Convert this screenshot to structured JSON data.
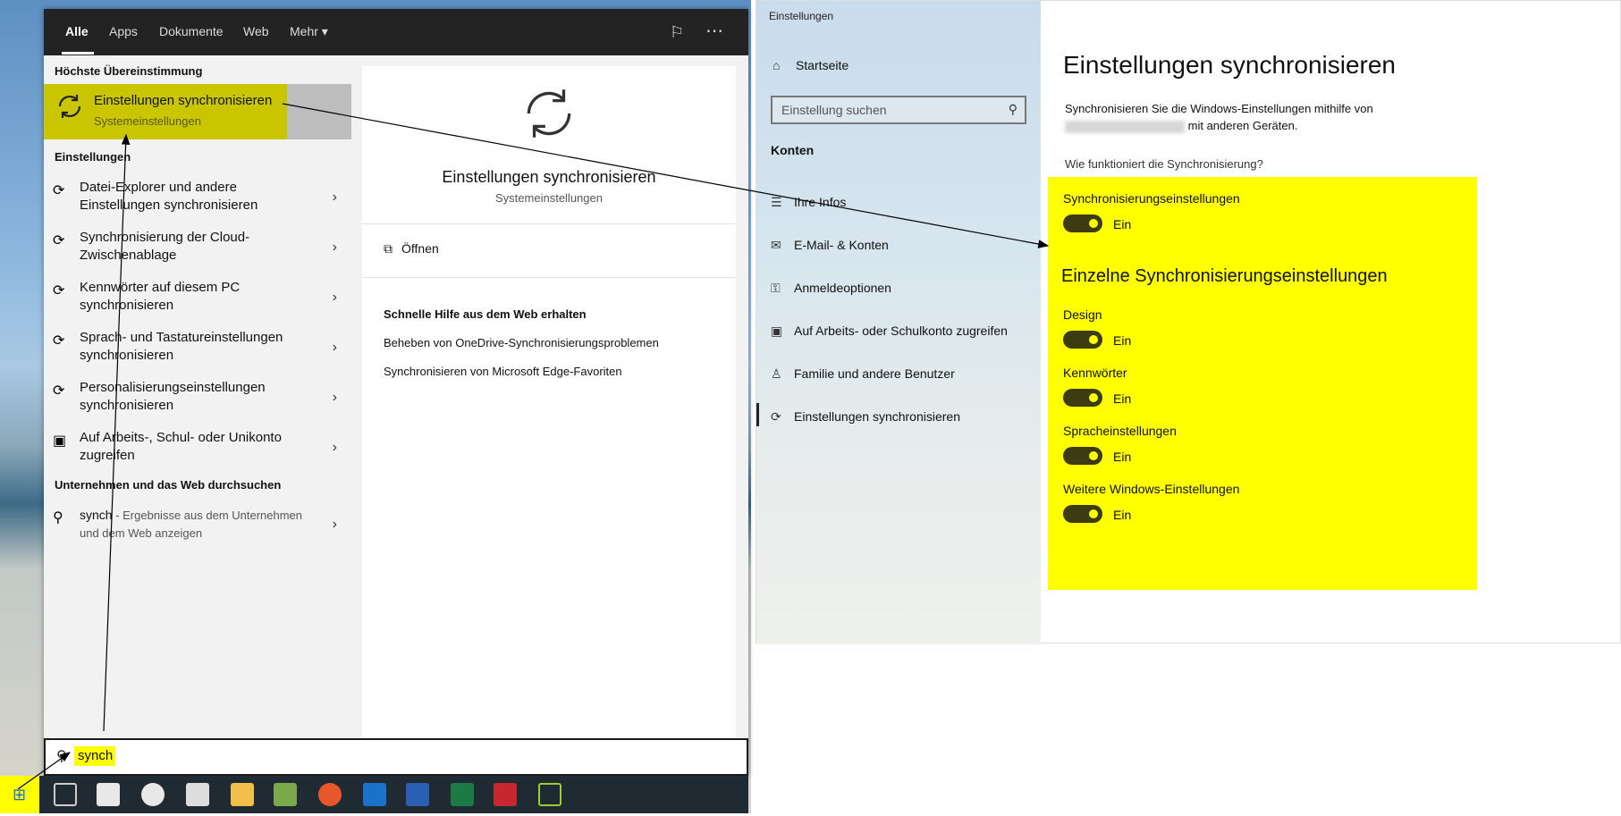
{
  "start_menu": {
    "tabs": [
      "Alle",
      "Apps",
      "Dokumente",
      "Web",
      "Mehr"
    ],
    "best_match_heading": "Höchste Übereinstimmung",
    "best_match": {
      "title": "Einstellungen synchronisieren",
      "subtitle": "Systemeinstellungen"
    },
    "settings_heading": "Einstellungen",
    "results": [
      {
        "line1": "Datei-Explorer und andere",
        "line2": "Einstellungen synchronisieren"
      },
      {
        "line1": "Synchronisierung der Cloud-",
        "line2": "Zwischenablage"
      },
      {
        "line1": "Kennwörter auf diesem PC",
        "line2": "synchronisieren"
      },
      {
        "line1": "Sprach- und Tastatureinstellungen",
        "line2": "synchronisieren"
      },
      {
        "line1": "Personalisierungseinstellungen",
        "line2": "synchronisieren"
      },
      {
        "line1": "Auf Arbeits-, Schul- oder Unikonto",
        "line2": "zugreifen"
      }
    ],
    "web_heading": "Unternehmen und das Web durchsuchen",
    "web_result": {
      "query": "synch",
      "line1": " - Ergebnisse aus dem Unternehmen",
      "line2": "und dem Web anzeigen"
    },
    "preview": {
      "title": "Einstellungen synchronisieren",
      "subtitle": "Systemeinstellungen",
      "open": "Öffnen",
      "web_help_heading": "Schnelle Hilfe aus dem Web erhalten",
      "web_links": [
        "Beheben von OneDrive-Synchronisierungsproblemen",
        "Synchronisieren von Microsoft Edge-Favoriten"
      ]
    },
    "search_value": "synch"
  },
  "settings": {
    "window_title": "Einstellungen",
    "home": "Startseite",
    "search_placeholder": "Einstellung suchen",
    "section": "Konten",
    "nav": [
      "Ihre Infos",
      "E-Mail- & Konten",
      "Anmeldeoptionen",
      "Auf Arbeits- oder Schulkonto zugreifen",
      "Familie und andere Benutzer",
      "Einstellungen synchronisieren"
    ],
    "page_title": "Einstellungen synchronisieren",
    "description_line1": "Synchronisieren Sie die Windows-Einstellungen mithilfe von",
    "description_line2": "mit anderen Geräten.",
    "how_link": "Wie funktioniert die Synchronisierung?",
    "main_toggle": {
      "label": "Synchronisierungseinstellungen",
      "state": "Ein"
    },
    "individual_heading": "Einzelne Synchronisierungseinstellungen",
    "toggles": [
      {
        "label": "Design",
        "state": "Ein"
      },
      {
        "label": "Kennwörter",
        "state": "Ein"
      },
      {
        "label": "Spracheinstellungen",
        "state": "Ein"
      },
      {
        "label": "Weitere Windows-Einstellungen",
        "state": "Ein"
      }
    ]
  },
  "colors": {
    "highlight": "#ffff00",
    "best_match_bg": "#c9c600",
    "toggle_on": "#3d3b12"
  }
}
